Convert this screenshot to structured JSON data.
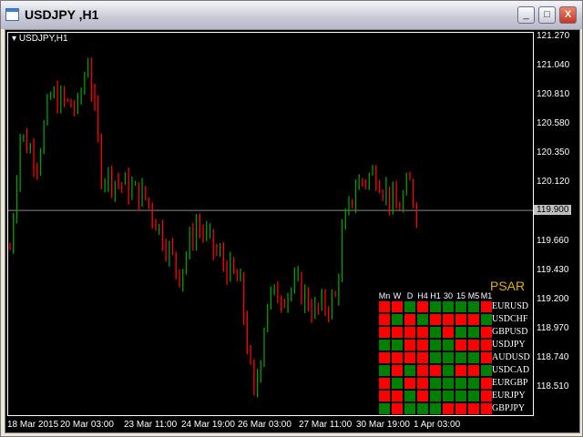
{
  "window": {
    "title": "USDJPY ,H1",
    "buttons": [
      "_",
      "□",
      "X"
    ]
  },
  "chart": {
    "label": "USDJPY,H1",
    "current_price": "119.900",
    "price_labels": [
      "121.270",
      "121.040",
      "120.810",
      "120.580",
      "120.350",
      "120.120",
      "119.660",
      "119.430",
      "119.200",
      "118.970",
      "118.740",
      "118.510"
    ],
    "time_labels": [
      "18 Mar 2015",
      "20 Mar 03:00",
      "23 Mar 11:00",
      "24 Mar 19:00",
      "26 Mar 03:00",
      "27 Mar 11:00",
      "30 Mar 19:00",
      "1 Apr 03:00"
    ]
  },
  "chart_data": {
    "type": "candlestick",
    "ylim": [
      118.3,
      121.32
    ],
    "current": 119.9,
    "keypoints": [
      [
        0,
        119.6
      ],
      [
        3,
        120.5
      ],
      [
        8,
        120.3
      ],
      [
        12,
        120.8
      ],
      [
        20,
        120.7
      ],
      [
        23,
        121.1
      ],
      [
        27,
        120.2
      ],
      [
        40,
        120.0
      ],
      [
        45,
        119.7
      ],
      [
        50,
        119.4
      ],
      [
        55,
        119.8
      ],
      [
        60,
        119.6
      ],
      [
        68,
        119.3
      ],
      [
        72,
        118.4
      ],
      [
        76,
        119.2
      ],
      [
        85,
        119.3
      ],
      [
        90,
        119.1
      ],
      [
        96,
        119.2
      ],
      [
        98,
        119.7
      ],
      [
        102,
        120.1
      ],
      [
        108,
        120.2
      ],
      [
        114,
        119.9
      ],
      [
        118,
        120.1
      ],
      [
        120,
        119.9
      ]
    ],
    "up_color": "#00a000",
    "down_color": "#ff0000"
  },
  "psar": {
    "title": "PSAR",
    "timeframes": [
      "Mn",
      "W",
      "D",
      "H4",
      "H1",
      "30",
      "15",
      "M5",
      "M1"
    ],
    "pairs": [
      {
        "name": "EURUSD",
        "signals": "RRGRGGGGR"
      },
      {
        "name": "USDCHF",
        "signals": "RGRGRRRRG"
      },
      {
        "name": "GBPUSD",
        "signals": "RRRRGRGGR"
      },
      {
        "name": "USDJPY",
        "signals": "GGRRGGRRR"
      },
      {
        "name": "AUDUSD",
        "signals": "RRRRGGGGR"
      },
      {
        "name": "USDCAD",
        "signals": "GRGRRGRRG"
      },
      {
        "name": "EURGBP",
        "signals": "RGRRGGGGR"
      },
      {
        "name": "EURJPY",
        "signals": "RRGRGGGGR"
      },
      {
        "name": "GBPJPY",
        "signals": "GRGGGRRRR"
      }
    ],
    "colors": {
      "R": "#ff0000",
      "G": "#008000"
    }
  }
}
